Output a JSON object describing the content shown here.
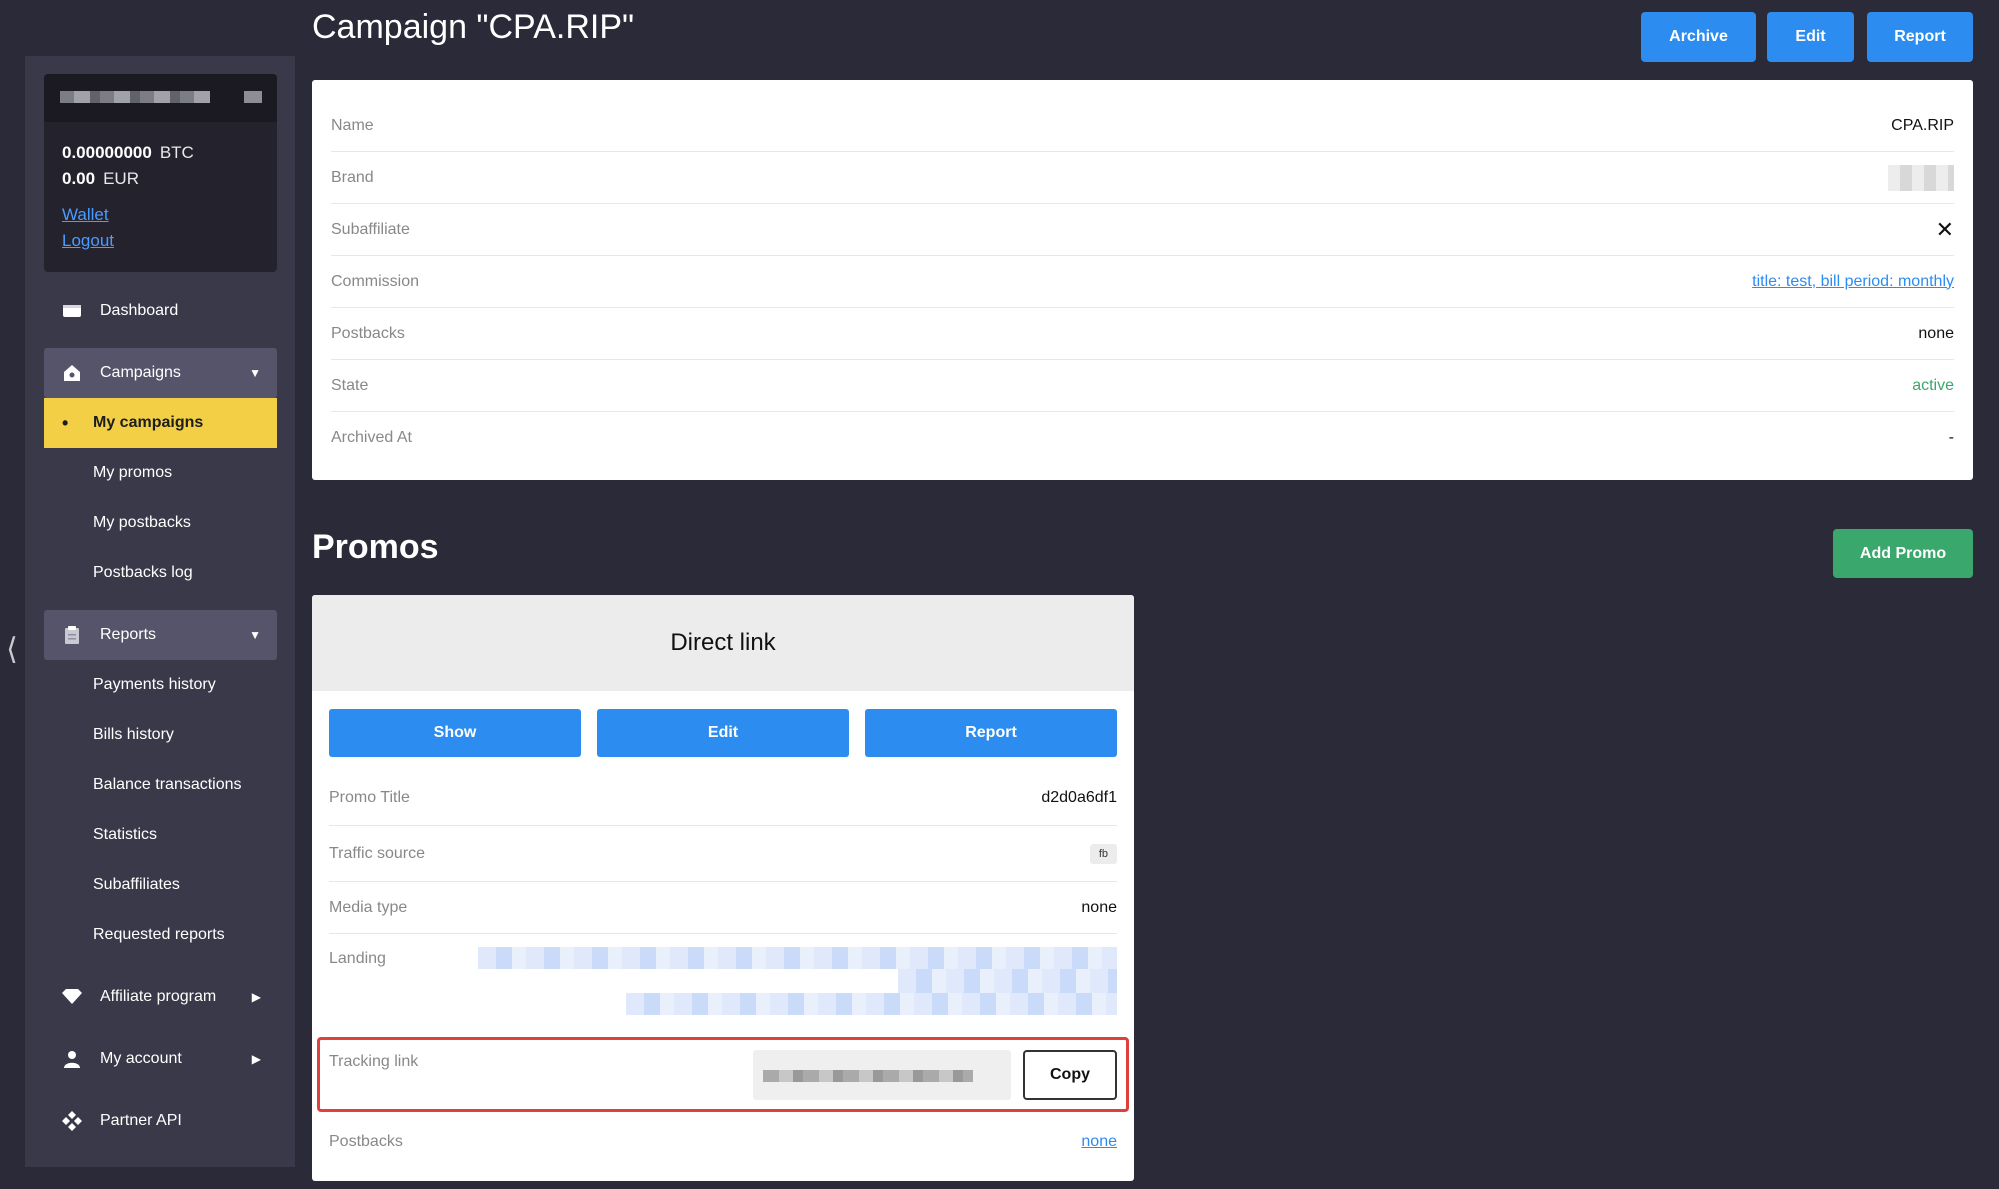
{
  "account": {
    "btc_amount": "0.00000000",
    "btc_label": "BTC",
    "eur_amount": "0.00",
    "eur_label": "EUR",
    "wallet_link": "Wallet",
    "logout_link": "Logout"
  },
  "sidebar": {
    "dashboard": "Dashboard",
    "campaigns": "Campaigns",
    "campaign_items": [
      "My campaigns",
      "My promos",
      "My postbacks",
      "Postbacks log"
    ],
    "reports": "Reports",
    "report_items": [
      "Payments history",
      "Bills history",
      "Balance transactions",
      "Statistics",
      "Subaffiliates",
      "Requested reports"
    ],
    "affiliate_program": "Affiliate program",
    "my_account": "My account",
    "partner_api": "Partner API"
  },
  "header": {
    "title": "Campaign \"CPA.RIP\"",
    "archive_label": "Archive",
    "edit_label": "Edit",
    "report_label": "Report"
  },
  "campaign": {
    "rows": [
      {
        "label": "Name",
        "value": "CPA.RIP"
      },
      {
        "label": "Brand",
        "value": ""
      },
      {
        "label": "Subaffiliate",
        "value": "✕"
      },
      {
        "label": "Commission",
        "value": "title: test, bill period: monthly"
      },
      {
        "label": "Postbacks",
        "value": "none"
      },
      {
        "label": "State",
        "value": "active"
      },
      {
        "label": "Archived At",
        "value": "-"
      }
    ]
  },
  "promos": {
    "title": "Promos",
    "add_label": "Add Promo",
    "card": {
      "heading": "Direct link",
      "show_label": "Show",
      "edit_label": "Edit",
      "report_label": "Report",
      "promo_title_label": "Promo Title",
      "promo_title_value": "d2d0a6df1",
      "traffic_source_label": "Traffic source",
      "traffic_source_value": "fb",
      "media_type_label": "Media type",
      "media_type_value": "none",
      "landing_label": "Landing",
      "tracking_link_label": "Tracking link",
      "copy_label": "Copy",
      "postbacks_label": "Postbacks",
      "postbacks_value": "none"
    }
  },
  "colors": {
    "background": "#2b2a38",
    "sidebar": "#3a3949",
    "primary_button": "#2d8cf0",
    "success": "#3aa76d",
    "active_nav": "#f2cf45",
    "highlight_border": "#e0403c"
  }
}
